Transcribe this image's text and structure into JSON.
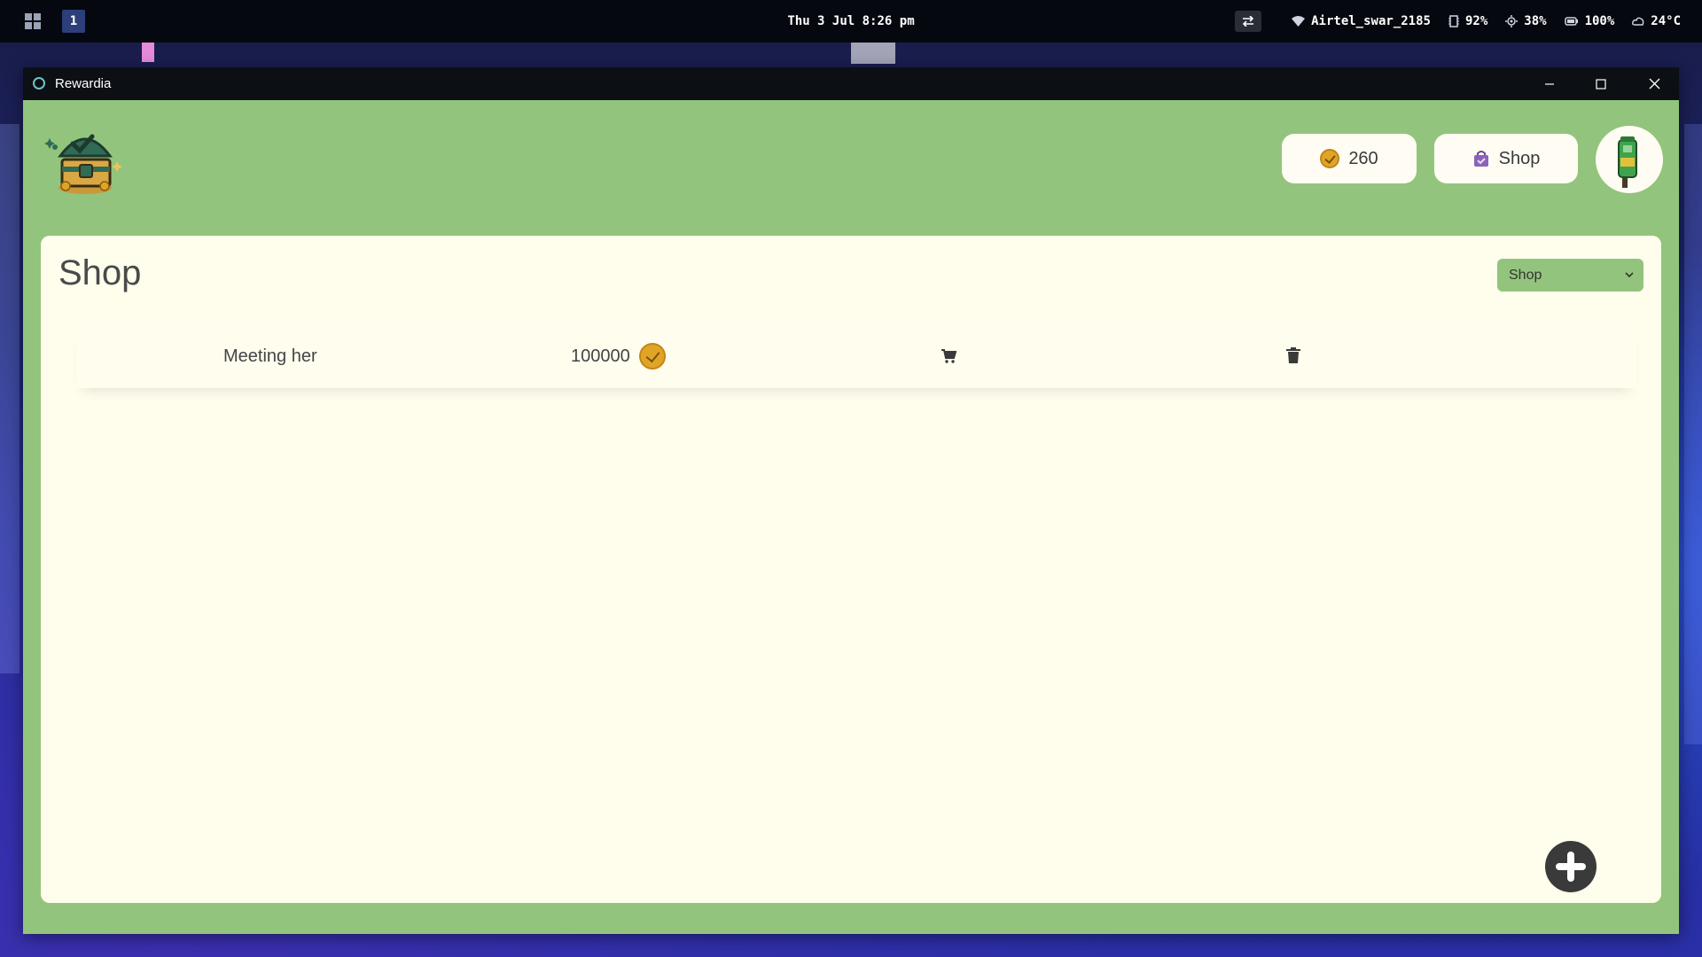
{
  "taskbar": {
    "workspace": "1",
    "clock": "Thu 3 Jul 8:26 pm",
    "wifi": "Airtel_swar_2185",
    "memory": "92%",
    "cpu": "38%",
    "battery": "100%",
    "temperature": "24°C"
  },
  "window": {
    "title": "Rewardia"
  },
  "header": {
    "coins": "260",
    "shop_label": "Shop"
  },
  "page": {
    "title": "Shop",
    "filter_selected": "Shop"
  },
  "items": [
    {
      "name": "Meeting her",
      "price": "100000"
    }
  ],
  "colors": {
    "app_background": "#93c47d",
    "card_background": "#fffdec",
    "coin": "#e0a526",
    "fab": "#3a3a3a"
  },
  "icons": [
    "windows-icon",
    "swap-icon",
    "wifi-icon",
    "memory-icon",
    "cpu-icon",
    "battery-icon",
    "weather-icon",
    "coin-icon",
    "shopping-bag-icon",
    "cart-icon",
    "trash-icon",
    "plus-icon"
  ]
}
